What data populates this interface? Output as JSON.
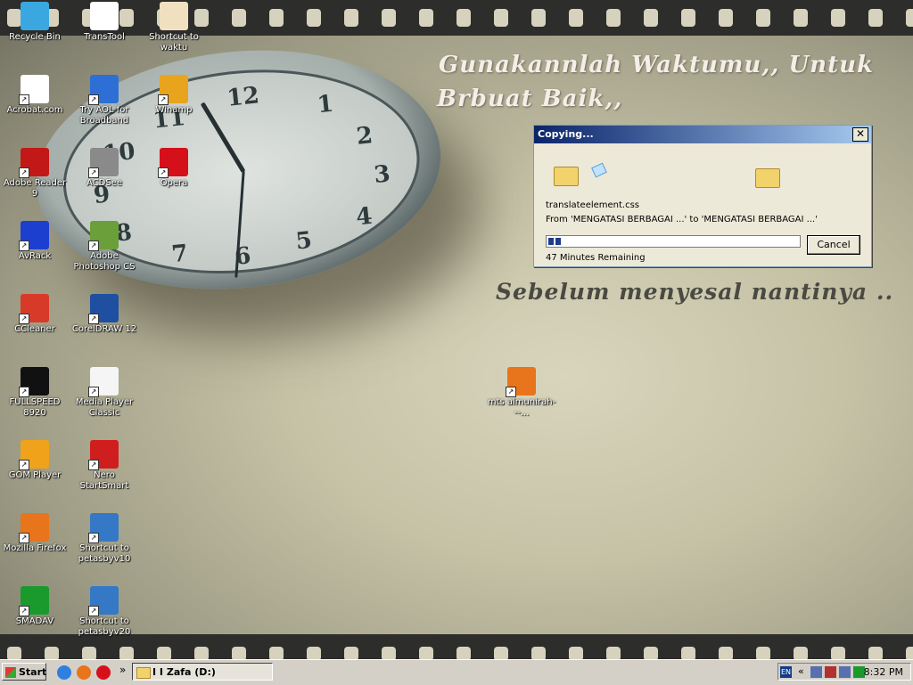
{
  "wallpaper": {
    "line1": "Gunakannlah Waktumu,, Untuk",
    "line2": "Brbuat Baik,,",
    "line3": "Sebelum menyesal nantinya .."
  },
  "desktop_icons": [
    {
      "label": "Recycle Bin",
      "icon": "recycle-bin-icon",
      "color": "#3aa7e0"
    },
    {
      "label": "TransTool",
      "icon": "transtool-icon",
      "color": "#ffffff"
    },
    {
      "label": "Shortcut to waktu",
      "icon": "document-shortcut-icon",
      "color": "#f0e0c0"
    },
    {
      "label": "Acrobat.com",
      "icon": "acrobat-icon",
      "color": "#ffffff"
    },
    {
      "label": "Try AOL for Broadband",
      "icon": "aol-icon",
      "color": "#2d6fd4"
    },
    {
      "label": "Winamp",
      "icon": "winamp-icon",
      "color": "#e8a41c"
    },
    {
      "label": "Adobe Reader 9",
      "icon": "adobe-reader-icon",
      "color": "#c31818"
    },
    {
      "label": "ACDSee",
      "icon": "acdsee-icon",
      "color": "#8a8a8a"
    },
    {
      "label": "Opera",
      "icon": "opera-icon",
      "color": "#d6101b"
    },
    {
      "label": "AvRack",
      "icon": "avrack-icon",
      "color": "#1c3fd0"
    },
    {
      "label": "Adobe Photoshop CS",
      "icon": "photoshop-icon",
      "color": "#6a9f3a"
    },
    {
      "label": "CCleaner",
      "icon": "ccleaner-icon",
      "color": "#d83a2a"
    },
    {
      "label": "CorelDRAW 12",
      "icon": "coreldraw-icon",
      "color": "#1f4fa0"
    },
    {
      "label": "FULLSPEED 8920",
      "icon": "fullspeed-icon",
      "color": "#111111"
    },
    {
      "label": "Media Player Classic",
      "icon": "media-player-classic-icon",
      "color": "#f5f5f5"
    },
    {
      "label": "GOM Player",
      "icon": "gom-player-icon",
      "color": "#f0a21a"
    },
    {
      "label": "Nero StartSmart",
      "icon": "nero-icon",
      "color": "#d01d1d"
    },
    {
      "label": "Mozilla Firefox",
      "icon": "firefox-icon",
      "color": "#e8741c"
    },
    {
      "label": "Shortcut to petasbyv10",
      "icon": "flash-shortcut-icon",
      "color": "#3478c6"
    },
    {
      "label": "SMADAV",
      "icon": "smadav-icon",
      "color": "#1a9a2c"
    },
    {
      "label": "Shortcut to petasbyv20",
      "icon": "flash-shortcut-icon",
      "color": "#3478c6"
    },
    {
      "label": "mts almunirah---...",
      "icon": "firefox-document-icon",
      "color": "#e8741c"
    }
  ],
  "dialog": {
    "title": "Copying...",
    "close_label": "✕",
    "filename": "translateelement.css",
    "from_to": "From 'MENGATASI BERBAGAI ...' to 'MENGATASI BERBAGAI ...'",
    "progress_fraction": 0.05,
    "remaining": "47 Minutes Remaining",
    "cancel_label": "Cancel"
  },
  "taskbar": {
    "start_label": "Start",
    "quicklaunch": [
      "internet-explorer-icon",
      "firefox-icon",
      "opera-icon"
    ],
    "overflow": "»",
    "task_label": "I I Zafa (D:)",
    "tray": {
      "lang": "EN",
      "chevron": "«",
      "time": "8:32 PM"
    }
  }
}
